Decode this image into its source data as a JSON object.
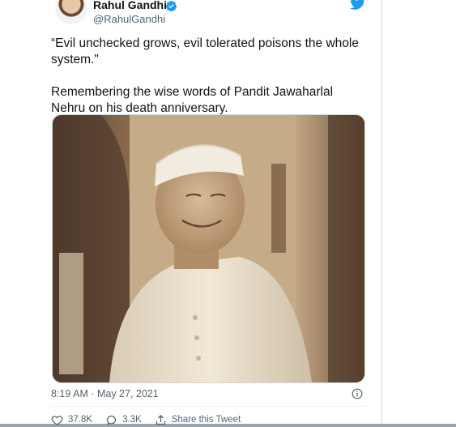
{
  "tweet": {
    "author": {
      "display_name": "Rahul Gandhi",
      "handle": "@RahulGandhi",
      "verified": true
    },
    "paragraphs": [
      "“Evil unchecked grows, evil tolerated poisons the whole system.\"",
      "Remembering the wise words of Pandit Jawaharlal Nehru on his death anniversary."
    ],
    "timestamp": "8:19 AM · May 27, 2021",
    "actions": {
      "likes": "37.8K",
      "replies": "3.3K",
      "share_label": "Share this Tweet"
    }
  },
  "icons": {
    "brand": "twitter-bird-icon",
    "verified": "verified-badge-icon",
    "info": "info-icon",
    "like": "heart-icon",
    "reply": "reply-bubble-icon",
    "share": "share-icon"
  },
  "colors": {
    "brand_blue": "#1d9bf0",
    "text_primary": "#0f1419",
    "text_secondary": "#536471"
  }
}
